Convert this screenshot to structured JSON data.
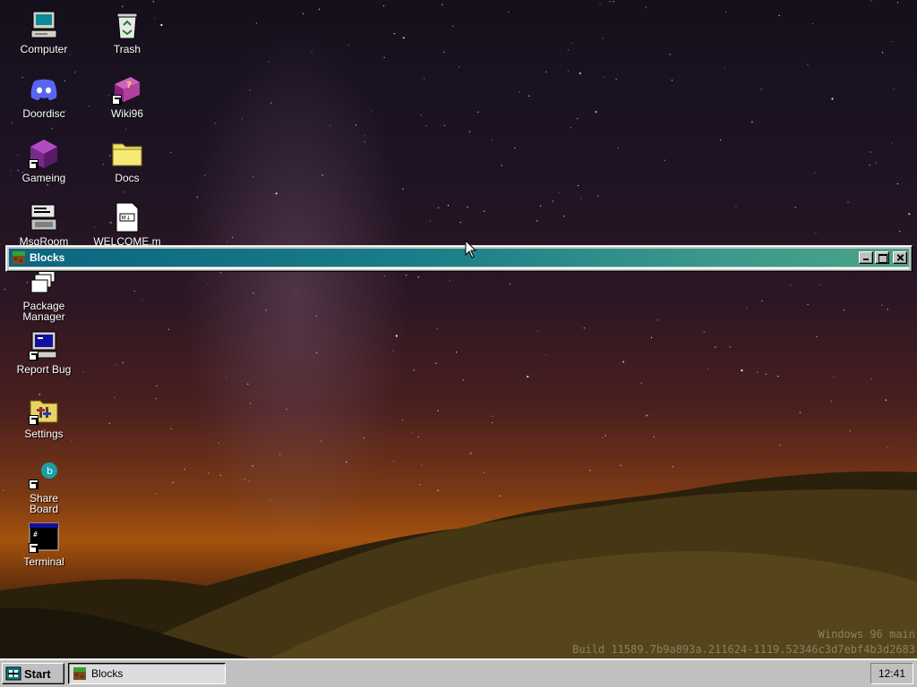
{
  "desktop": {
    "icons": [
      {
        "label": "Computer",
        "icon": "computer-icon"
      },
      {
        "label": "Trash",
        "icon": "trash-icon"
      },
      {
        "label": "Doordisc",
        "icon": "discord-icon"
      },
      {
        "label": "Wiki96",
        "icon": "wiki-book-icon"
      },
      {
        "label": "Gameing",
        "icon": "game-cube-icon"
      },
      {
        "label": "Docs",
        "icon": "folder-icon"
      },
      {
        "label": "MsgRoom",
        "icon": "msgroom-icon"
      },
      {
        "label": "WELCOME.m",
        "icon": "markdown-file-icon"
      },
      {
        "label": "Package\nManager",
        "icon": "package-manager-icon"
      },
      {
        "label": "Report Bug",
        "icon": "report-bug-icon"
      },
      {
        "label": "Settings",
        "icon": "settings-icon"
      },
      {
        "label": "Share\nBoard",
        "icon": "share-board-icon"
      },
      {
        "label": "Terminal",
        "icon": "terminal-icon"
      }
    ]
  },
  "window": {
    "title": "Blocks",
    "icon": "blocks-icon",
    "buttons": [
      "minimize",
      "maximize",
      "close"
    ]
  },
  "watermark": {
    "line1": "Windows 96 main",
    "line2": "Build 11589.7b9a893a.211624-1119.52346c3d7ebf4b3d2683"
  },
  "taskbar": {
    "start_label": "Start",
    "tasks": [
      {
        "label": "Blocks",
        "icon": "blocks-icon"
      }
    ],
    "clock": "12:41"
  },
  "colors": {
    "titlebar_start": "#0a6680",
    "titlebar_end": "#4aa388",
    "chrome": "#c0c0c0"
  }
}
